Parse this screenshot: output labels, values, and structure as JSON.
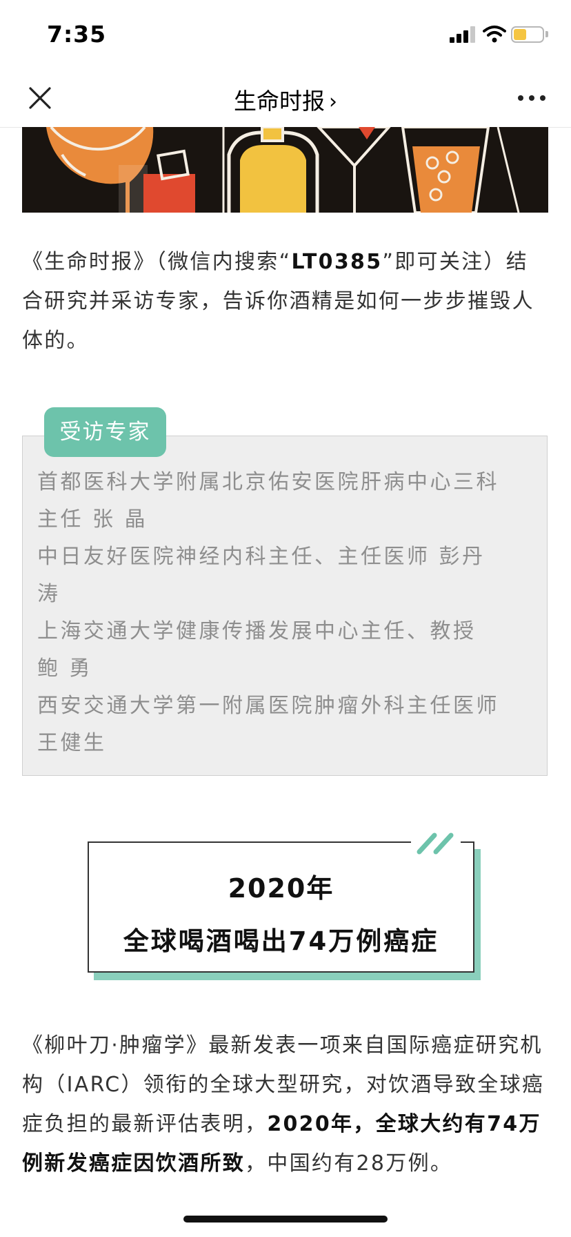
{
  "status_bar": {
    "time": "7:35",
    "battery_level": 0.45,
    "battery_color": "#f5c542"
  },
  "nav": {
    "title": "生命时报",
    "chevron": "›",
    "close_icon": "close-icon",
    "more_icon": "more-dots-icon"
  },
  "intro": {
    "part1": "《生命时报》（微信内搜索“",
    "highlight": "LT0385",
    "part2": "”即可关注）结合研究并采访专家，告诉你酒精是如何一步步摧毁人体的。"
  },
  "experts": {
    "badge": "受访专家",
    "lines": [
      "首都医科大学附属北京佑安医院肝病中心三科",
      "主任 张 晶",
      "中日友好医院神经内科主任、主任医师 彭丹",
      "涛",
      "上海交通大学健康传播发展中心主任、教授",
      "鲍 勇",
      "西安交通大学第一附属医院肿瘤外科主任医师",
      "王健生"
    ]
  },
  "section": {
    "year": "2020年",
    "title": "全球喝酒喝出74万例癌症",
    "accent_color": "#6dc3ab"
  },
  "body": {
    "text1": "《柳叶刀·肿瘤学》最新发表一项来自国际癌症研究机构（IARC）领衔的全球大型研究，对饮酒导致全球癌症负担的最新评估表明，",
    "bold1": "2020年，全球大约有74万例新发癌症因饮酒所致",
    "text2": "，中国约有28万例。"
  }
}
